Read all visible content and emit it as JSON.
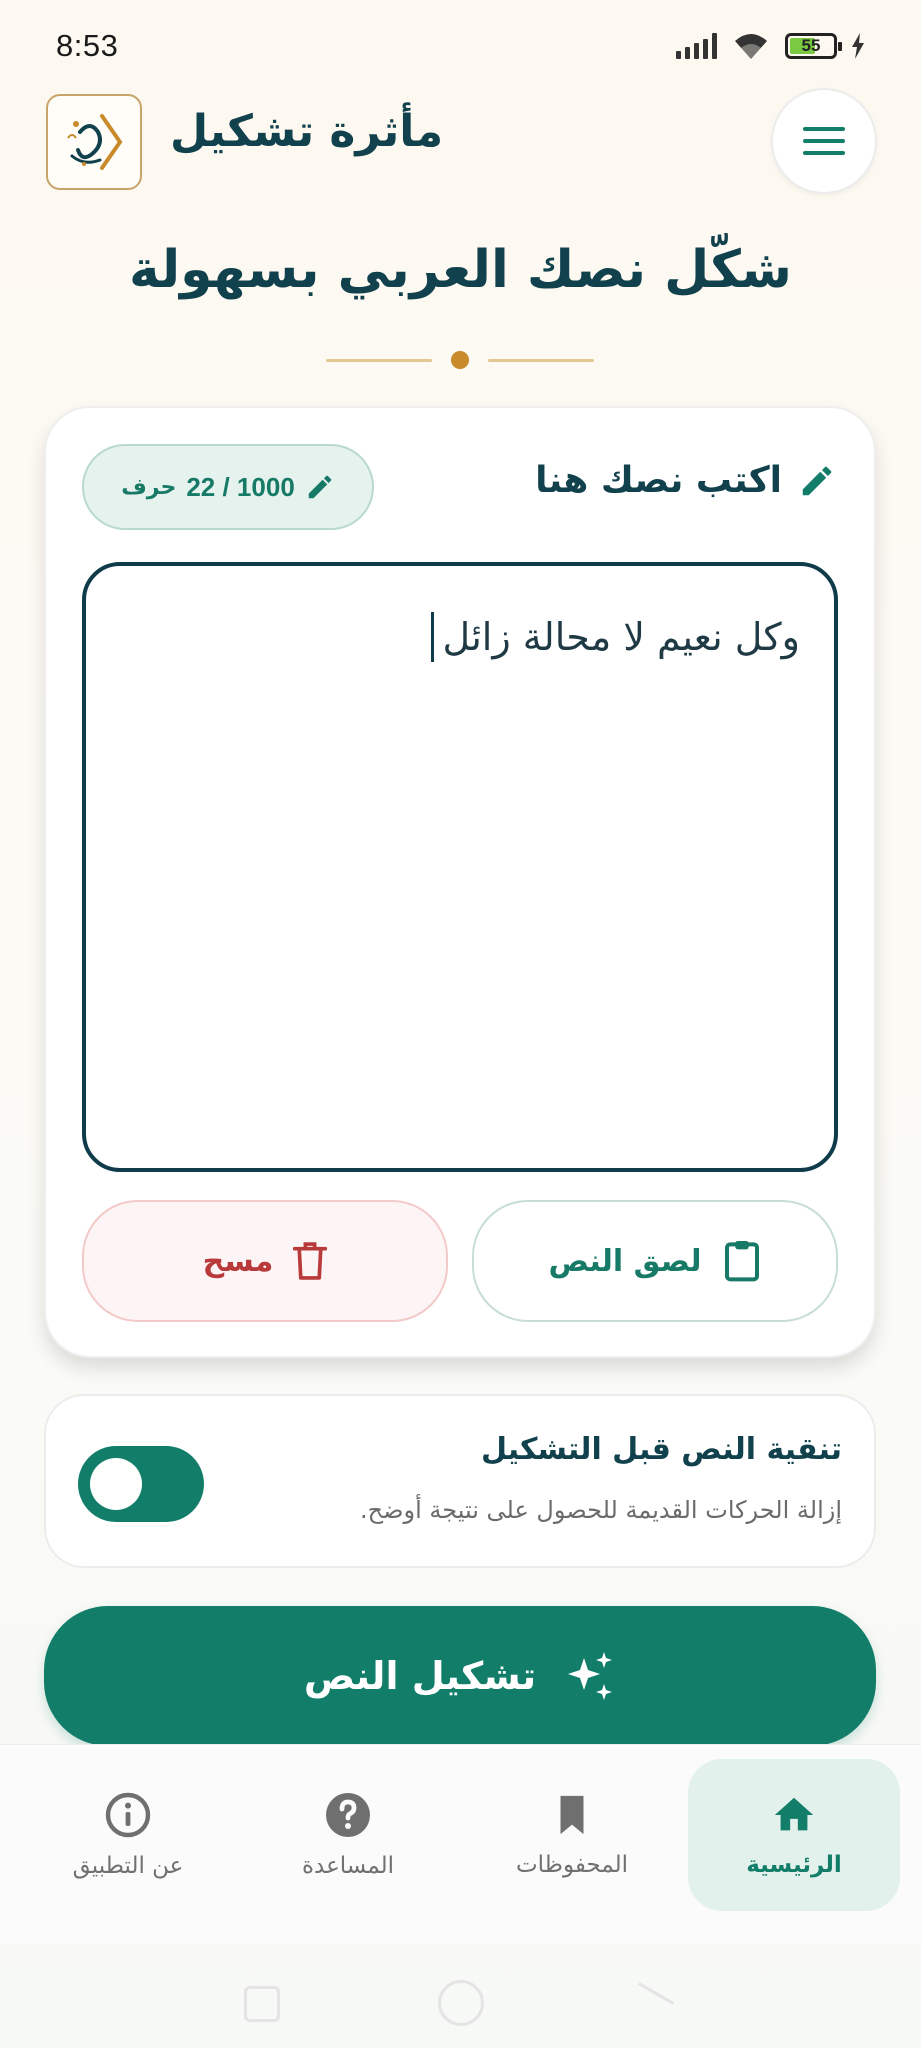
{
  "status": {
    "time": "8:53",
    "battery": "55"
  },
  "header": {
    "app_title": "مأثرة تشكيل",
    "logo_icon": "calligraphy-logo-icon",
    "menu_icon": "hamburger-menu-icon"
  },
  "hero": {
    "headline": "شكّل نصك العربي بسهولة"
  },
  "editor_card": {
    "title": "اكتب نصك هنا",
    "counter_value": "22 / 1000",
    "counter_unit": "حرف",
    "text_value": "وكل نعيم لا محالة زائل",
    "paste_label": "لصق النص",
    "clear_label": "مسح"
  },
  "clean_option": {
    "title": "تنقية النص قبل التشكيل",
    "description": "إزالة الحركات القديمة للحصول على نتيجة أوضح.",
    "enabled": true
  },
  "primary_action": {
    "label": "تشكيل النص"
  },
  "bottom_nav": {
    "items": [
      {
        "label": "الرئيسية",
        "icon": "home-icon",
        "active": true
      },
      {
        "label": "المحفوظات",
        "icon": "bookmark-icon",
        "active": false
      },
      {
        "label": "المساعدة",
        "icon": "help-icon",
        "active": false
      },
      {
        "label": "عن التطبيق",
        "icon": "info-icon",
        "active": false
      }
    ]
  },
  "colors": {
    "primary": "#127e69",
    "title": "#11414d",
    "accent_gold": "#c98a2c",
    "danger": "#b83a3a"
  }
}
